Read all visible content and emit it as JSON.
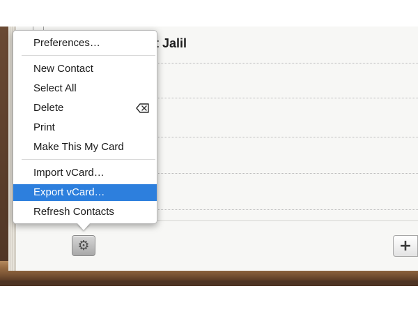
{
  "contact": {
    "name_fragment": "t Jalil"
  },
  "menu": {
    "items": [
      {
        "label": "Preferences…"
      },
      {
        "label": "New Contact"
      },
      {
        "label": "Select All"
      },
      {
        "label": "Delete"
      },
      {
        "label": "Print"
      },
      {
        "label": "Make This My Card"
      },
      {
        "label": "Import vCard…"
      },
      {
        "label": "Export vCard…",
        "selected": true
      },
      {
        "label": "Refresh Contacts"
      }
    ],
    "delete_shortcut_icon": "delete-key-icon"
  },
  "toolbar": {
    "action_icon": "gear-icon",
    "add_icon": "plus-icon"
  },
  "colors": {
    "selection": "#2d7fdd",
    "leather": "#5b3e2b",
    "wood_edge": "#9a6e45",
    "page": "#f7f7f5"
  }
}
